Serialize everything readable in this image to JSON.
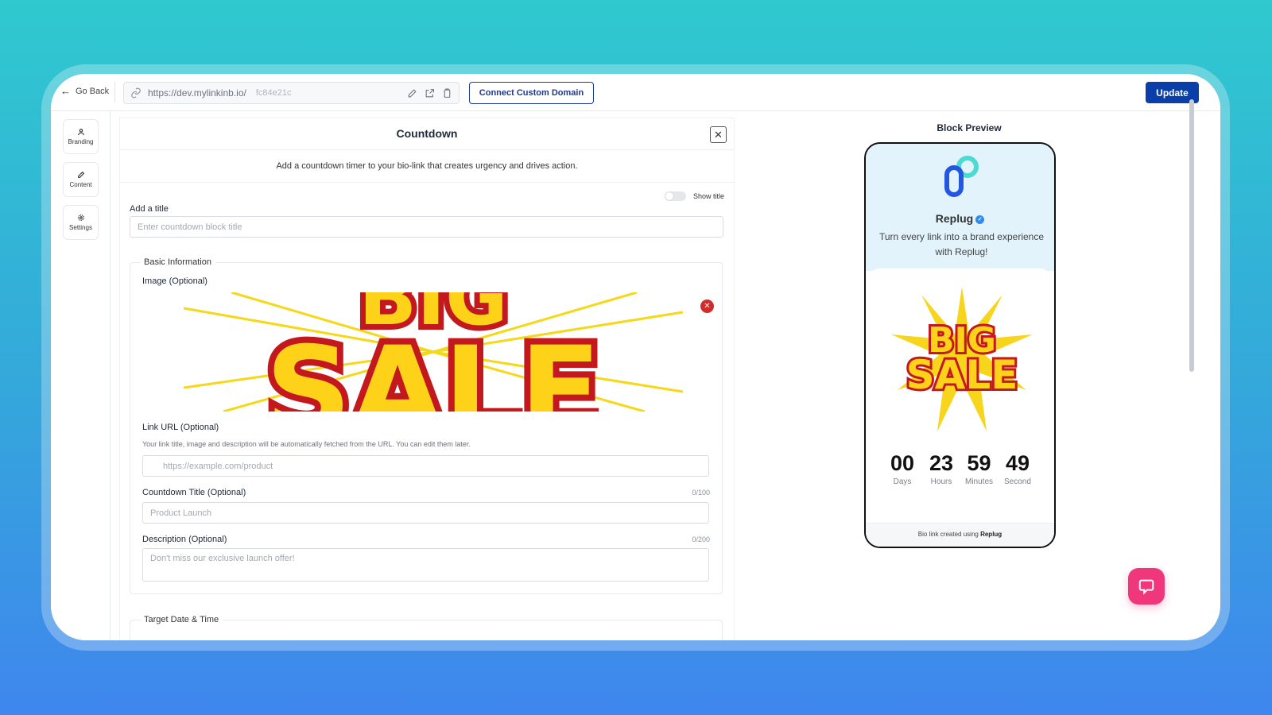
{
  "topbar": {
    "go_back": "Go Back",
    "url": "https://dev.mylinkinb.io/",
    "slug": "fc84e21c",
    "connect_domain": "Connect Custom Domain",
    "update": "Update"
  },
  "sidebar": {
    "items": [
      {
        "label": "Branding",
        "icon": "user-icon"
      },
      {
        "label": "Content",
        "icon": "pencil-icon"
      },
      {
        "label": "Settings",
        "icon": "gear-icon"
      }
    ]
  },
  "editor": {
    "title": "Countdown",
    "subtitle": "Add a countdown timer to your bio-link that creates urgency and drives action.",
    "show_title_label": "Show title",
    "show_title_on": false,
    "add_title_label": "Add a title",
    "add_title_placeholder": "Enter countdown block title",
    "basic_info_legend": "Basic Information",
    "image_label": "Image (Optional)",
    "link_url_label": "Link URL (Optional)",
    "link_url_hint": "Your link title, image and description will be automatically fetched from the URL. You can edit them later.",
    "link_url_placeholder": "https://example.com/product",
    "countdown_title_label": "Countdown Title (Optional)",
    "countdown_title_counter": "0/100",
    "countdown_title_placeholder": "Product Launch",
    "description_label": "Description (Optional)",
    "description_counter": "0/200",
    "description_placeholder": "Don't miss our exclusive launch offer!",
    "target_legend": "Target Date & Time",
    "sale_image_text": [
      "BIG",
      "SALE"
    ]
  },
  "preview": {
    "title": "Block Preview",
    "brand_name": "Replug",
    "tagline_line1": "Turn every link into a brand experience",
    "tagline_line2": "with Replug!",
    "countdown": [
      {
        "value": "00",
        "unit": "Days"
      },
      {
        "value": "23",
        "unit": "Hours"
      },
      {
        "value": "59",
        "unit": "Minutes"
      },
      {
        "value": "49",
        "unit": "Second"
      }
    ],
    "footer_prefix": "Bio link created using",
    "footer_brand": "Replug"
  },
  "colors": {
    "accent": "#0a3ea8",
    "chat_button": "#f0377c",
    "remove": "#d12c2c",
    "preview_header": "#e2f3fb"
  }
}
